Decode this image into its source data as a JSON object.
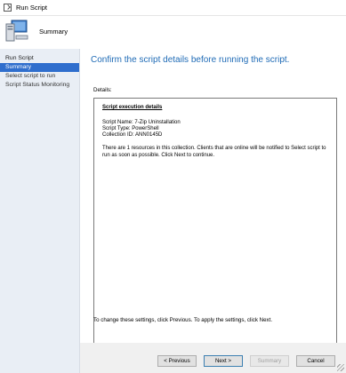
{
  "window": {
    "title": "Run Script"
  },
  "header": {
    "title": "Summary"
  },
  "sidebar": {
    "items": [
      {
        "label": "Run Script"
      },
      {
        "label": "Summary"
      },
      {
        "label": "Select script to run"
      },
      {
        "label": "Script Status Monitoring"
      }
    ]
  },
  "main": {
    "heading": "Confirm the script details before running the script.",
    "details_label": "Details:",
    "details": {
      "section_title": "Script execution details",
      "script_name": "Script Name: 7-Zip Uninstallation",
      "script_type": "Script Type: PowerShell",
      "collection_id": "Collection ID: ANN0145D",
      "notice": "There are 1 resources in this collection. Clients that are online will be notified to Select script to run as soon as possible. Click Next to continue."
    },
    "footer_note": "To change these settings, click Previous. To apply the settings, click Next."
  },
  "buttons": {
    "previous": "< Previous",
    "next": "Next >",
    "summary": "Summary",
    "cancel": "Cancel"
  },
  "colors": {
    "accent": "#1f6bb6",
    "sidebar_bg": "#e9eef5",
    "selected": "#2f6ecd"
  }
}
